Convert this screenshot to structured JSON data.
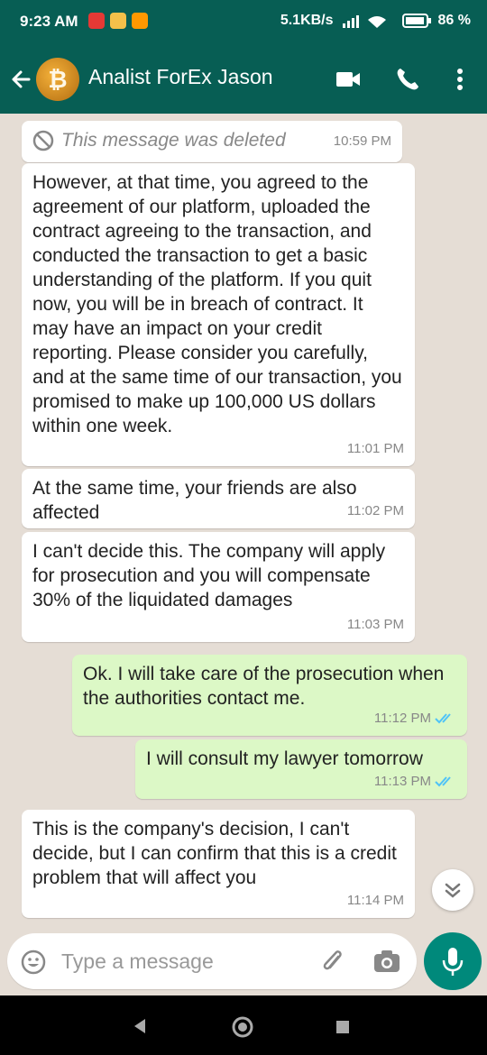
{
  "status": {
    "time": "9:23 AM",
    "speed": "5.1KB/s",
    "battery": "86"
  },
  "header": {
    "title": "Analist ForEx Jason",
    "avatar_symbol": "₿"
  },
  "messages": [
    {
      "kind": "deleted",
      "text": "This message was deleted",
      "time": "10:59 PM"
    },
    {
      "kind": "in",
      "text": "However, at that time, you agreed to the agreement of our platform, uploaded the contract agreeing to the transaction, and conducted the transaction to get a basic understanding of the platform. If you quit now, you will be in breach of contract. It may have an impact on your credit reporting. Please consider you carefully, and at the same time of our transaction, you promised to make up 100,000 US dollars within one week.",
      "time": "11:01 PM"
    },
    {
      "kind": "in",
      "text": "At the same time, your friends are also affected",
      "time": "11:02 PM"
    },
    {
      "kind": "in",
      "text": "I can't decide this. The company will apply for prosecution and you will compensate 30% of the liquidated damages",
      "time": "11:03 PM"
    },
    {
      "kind": "out",
      "text": "Ok. I will take care of the prosecution when the authorities contact me.",
      "time": "11:12 PM"
    },
    {
      "kind": "out",
      "text": "I will consult my lawyer tomorrow",
      "time": "11:13 PM"
    },
    {
      "kind": "in",
      "text": "This is the company's decision, I can't decide, but I can confirm that this is a credit problem that will affect you",
      "time": "11:14 PM"
    }
  ],
  "composer": {
    "placeholder": "Type a message"
  },
  "colors": {
    "header": "#075e54",
    "outgoing": "#dcf8c6",
    "accent": "#00897b",
    "read_ticks": "#4fc3f7"
  }
}
